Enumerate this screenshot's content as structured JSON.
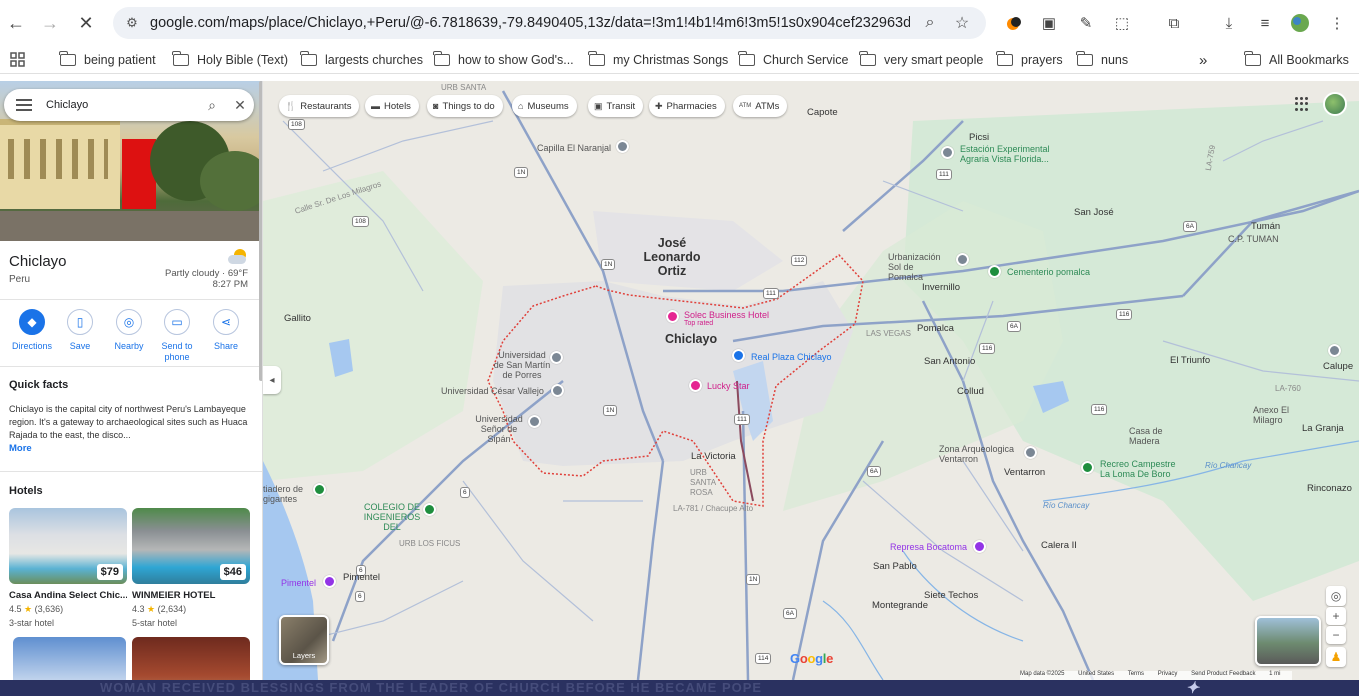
{
  "browser": {
    "url": "google.com/maps/place/Chiclayo,+Peru/@-6.7818639,-79.8490405,13z/data=!3m1!4b1!4m6!3m5!1s0x904cef232963dfff:...",
    "bookmarks": [
      "being patient",
      "Holy Bible (Text)",
      "largests churches",
      "how to show God's...",
      "my Christmas Songs",
      "Church Service",
      "very smart people",
      "prayers",
      "nuns"
    ],
    "all_bookmarks": "All Bookmarks",
    "overflow": "»"
  },
  "search": {
    "query": "Chiclayo"
  },
  "place": {
    "name": "Chiclayo",
    "country": "Peru",
    "weather": "Partly cloudy · 69°F",
    "time": "8:27 PM"
  },
  "actions": [
    {
      "label": "Directions",
      "icon": "directions-icon"
    },
    {
      "label": "Save",
      "icon": "bookmark-icon"
    },
    {
      "label": "Nearby",
      "icon": "nearby-icon"
    },
    {
      "label": "Send to phone",
      "icon": "phone-icon"
    },
    {
      "label": "Share",
      "icon": "share-icon"
    }
  ],
  "quick_facts": {
    "heading": "Quick facts",
    "text": "Chiclayo is the capital city of northwest Peru's Lambayeque region. It's a gateway to archaeological sites such as Huaca Rajada to the east, the disco...",
    "more": "More"
  },
  "hotels": {
    "heading": "Hotels",
    "items": [
      {
        "name": "Casa Andina Select Chic...",
        "rating": "4.5",
        "reviews": "(3,636)",
        "class": "3-star hotel",
        "price": "$79"
      },
      {
        "name": "WINMEIER HOTEL",
        "rating": "4.3",
        "reviews": "(2,634)",
        "class": "5-star hotel",
        "price": "$46"
      }
    ]
  },
  "chips": [
    "Restaurants",
    "Hotels",
    "Things to do",
    "Museums",
    "Transit",
    "Pharmacies",
    "ATMs"
  ],
  "map_labels": {
    "city": "Chiclayo",
    "jlo": "José Leonardo Ortiz",
    "la_victoria": "La Victoria",
    "capote": "Capote",
    "picsi": "Picsi",
    "estacion": "Estación Experimental Agraria Vista Florida...",
    "san_jose": "San José",
    "tuman": "Tumán",
    "cp_tuman": "C.P. TUMAN",
    "urbanizacion": "Urbanización Sol de Pomalca",
    "cementerio": "Cementerio pomalca",
    "invernillo": "Invernillo",
    "las_vegas": "LAS VEGAS",
    "pomalca": "Pomalca",
    "san_antonio": "San Antonio",
    "el_triunfo": "El Triunfo",
    "calupe": "Calupe",
    "collud": "Collud",
    "anexo": "Anexo El Milagro",
    "la_granja": "La Granja",
    "casa_madera": "Casa de Madera",
    "zona_arq": "Zona Arqueologica Ventarron",
    "ventarron": "Ventarron",
    "recreo": "Recreo Campestre La Loma De Boro",
    "rinconazo": "Rinconazo",
    "calera": "Calera II",
    "represa": "Represa Bocatoma",
    "san_pablo": "San Pablo",
    "siete_techos": "Siete Techos",
    "montegrande": "Montegrande",
    "gallito": "Gallito",
    "capilla": "Capilla El Naranjal",
    "urb_santa": "URB SANTA",
    "univ_san_martin": "Universidad de San Martín de Porres",
    "univ_cesar": "Universidad César Vallejo",
    "univ_sipan": "Universidad Señor de Sipán",
    "solec": "Solec Business Hotel",
    "top_rated": "Top rated",
    "real_plaza": "Real Plaza Chiclayo",
    "lucky_star": "Lucky Star",
    "colegio": "COLEGIO DE INGENIEROS DEL",
    "gigantes": "tiadero de gigantes",
    "urb_ficus": "URB LOS FICUS",
    "pimentel": "Pimentel",
    "pimentel2": "Pimentel",
    "calle": "Calle Sr. De Los Milagros",
    "chacupe": "LA-781 / Chacupe Alto",
    "urb_santa_rosa": "URB SANTA ROSA",
    "rio_chancay": "Río Chancay",
    "rio_chancay2": "Río Chancay",
    "la_760": "LA-760",
    "la_759": "LA-759"
  },
  "roads": [
    "1N",
    "1N",
    "1N",
    "1N",
    "111",
    "112",
    "111",
    "111",
    "108",
    "108",
    "6A",
    "6A",
    "6A",
    "6A",
    "116",
    "116",
    "116",
    "114",
    "6",
    "6",
    "6",
    "1N"
  ],
  "map_ui": {
    "layers": "Layers",
    "google": "Google",
    "attribution": [
      "Map data ©2025",
      "United States",
      "Terms",
      "Privacy",
      "Send Product Feedback",
      "1 mi"
    ]
  },
  "taskbar_text": "WOMAN RECEIVED BLESSINGS FROM THE LEADER OF CHURCH BEFORE HE BECAME POPE",
  "colors": {
    "accent": "#1a73e8",
    "boundary": "#e0403a",
    "road": "#8ea2c8",
    "park": "#bfe3c5",
    "water": "#a6c8f0"
  }
}
